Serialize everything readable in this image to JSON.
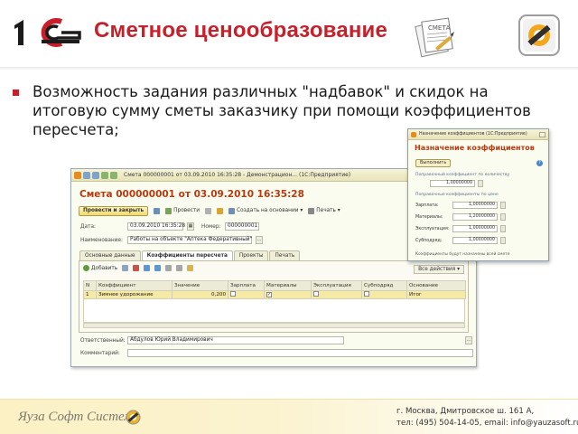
{
  "slide": {
    "title": "Сметное ценообразование",
    "bullet": "Возможность задания различных \"надбавок\" и скидок на итоговую сумму сметы заказчику при помощи коэффициентов пересчета;",
    "smeta_icon_label": "СМЕТА",
    "colors": {
      "title": "#c8202a",
      "bullet": "#c8202a",
      "footer": "#fbf1c4"
    }
  },
  "doc_window": {
    "title": "Смета 000000001 от 03.09.2010 16:35:28 - Демонстрацион... (1С:Предприятие)",
    "heading": "Смета 000000001 от 03.09.2010 16:35:28",
    "toolbar": {
      "post_close": "Провести и закрыть",
      "post": "Провести",
      "create_based": "Создать на основании ▾",
      "print": "Печать ▾",
      "help": "?"
    },
    "fields": {
      "date_label": "Дата:",
      "date_value": "03.09.2010 16:35:28",
      "number_label": "Номер:",
      "number_value": "000000001",
      "name_label": "Наименование:",
      "name_value": "Работы на объекте \"Аптека Федеративный\"",
      "responsible_label": "Ответственный:",
      "responsible_value": "Абдулов Юрий Владимирович",
      "comment_label": "Комментарий:",
      "comment_value": ""
    },
    "tabs": [
      "Основные данные",
      "Коэффициенты пересчета",
      "Проекты",
      "Печать"
    ],
    "active_tab": 1,
    "panel_toolbar": {
      "add": "Добавить",
      "all_actions": "Все действия ▾"
    },
    "table": {
      "columns": [
        "N",
        "Коэффициент",
        "Значение",
        "Зарплата",
        "Материалы",
        "Эксплуатация",
        "Субподряд",
        "Основание"
      ],
      "rows": [
        {
          "n": "1",
          "coef": "Зимнее удорожание",
          "value": "0,200",
          "salary": "",
          "materials": "✓",
          "operation": "",
          "subcontract": "",
          "basis": "Итог"
        }
      ]
    }
  },
  "coef_window": {
    "title": "Назначение коэффициентов   (1С:Предприятие)",
    "heading": "Назначение коэффициентов",
    "run": "Выполнить",
    "help": "?",
    "section_qty": "Поправочный коэффициент по количеству",
    "qty_value": "1,00000000",
    "section_price": "Поправочные коэффициенты по цене",
    "rows": [
      {
        "label": "Зарплата:",
        "value": "1,00000000"
      },
      {
        "label": "Материалы:",
        "value": "1,20000000"
      },
      {
        "label": "Эксплуатация:",
        "value": "1,00000000"
      },
      {
        "label": "Субподряд:",
        "value": "1,00000000"
      }
    ],
    "note": "Коэффициенты будут назначены всей смете"
  },
  "footer": {
    "brand": "Яуза Софт Системз",
    "address": "г. Москва, Дмитровское ш. 161 А,",
    "contacts": "тел: (495) 504-14-05, email: info@yauzasoft.ru"
  }
}
